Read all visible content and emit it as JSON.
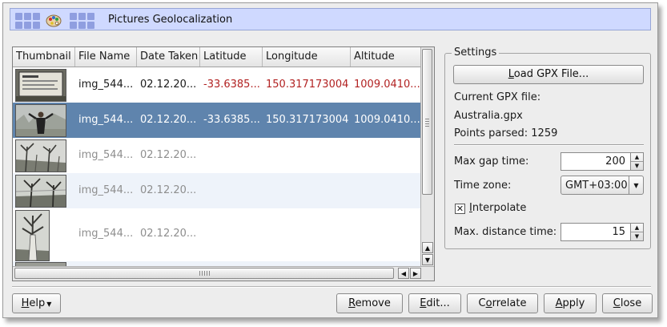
{
  "window": {
    "title": "Pictures Geolocalization"
  },
  "table": {
    "columns": [
      "Thumbnail",
      "File Name",
      "Date Taken",
      "Latitude",
      "Longitude",
      "Altitude"
    ],
    "rows": [
      {
        "file_name": "img_544...",
        "date": "02.12.20...",
        "latitude": "-33.6385...",
        "longitude": "150.317173004",
        "altitude": "1009.0410...",
        "state": "matched"
      },
      {
        "file_name": "img_544...",
        "date": "02.12.20...",
        "latitude": "-33.6385...",
        "longitude": "150.317173004",
        "altitude": "1009.0410...",
        "state": "selected"
      },
      {
        "file_name": "img_544...",
        "date": "02.12.20...",
        "latitude": "",
        "longitude": "",
        "altitude": "",
        "state": "unmatched"
      },
      {
        "file_name": "img_544...",
        "date": "02.12.20...",
        "latitude": "",
        "longitude": "",
        "altitude": "",
        "state": "unmatched"
      },
      {
        "file_name": "img_544...",
        "date": "02.12.20...",
        "latitude": "",
        "longitude": "",
        "altitude": "",
        "state": "unmatched"
      }
    ],
    "colors": {
      "selected_bg": "#5f84ad",
      "alt_row_bg": "#eef3fa",
      "gps_value": "#b22222",
      "disabled_text": "#8e8e8e"
    }
  },
  "settings": {
    "legend": "Settings",
    "load_button": {
      "prefix": "",
      "accel": "L",
      "rest": "oad GPX File..."
    },
    "current_file_label": "Current GPX file:",
    "current_file_value": "Australia.gpx",
    "points_parsed": "Points parsed: 1259",
    "max_gap_label": "Max gap time:",
    "max_gap_value": "200",
    "timezone_label": "Time zone:",
    "timezone_value": "GMT+03:00",
    "interpolate": {
      "accel": "I",
      "rest": "nterpolate",
      "checked": true,
      "mark": "✕"
    },
    "max_distance_label": "Max. distance time:",
    "max_distance_value": "15"
  },
  "buttons": {
    "help": {
      "accel": "H",
      "rest": "elp"
    },
    "remove": {
      "prefix": "",
      "accel": "R",
      "rest": "emove"
    },
    "edit": {
      "prefix": "",
      "accel": "E",
      "rest": "dit..."
    },
    "correlate": {
      "prefix": "C",
      "accel": "o",
      "rest": "rrelate"
    },
    "apply": {
      "prefix": "",
      "accel": "A",
      "rest": "pply"
    },
    "close": {
      "prefix": "",
      "accel": "C",
      "rest": "lose"
    }
  }
}
